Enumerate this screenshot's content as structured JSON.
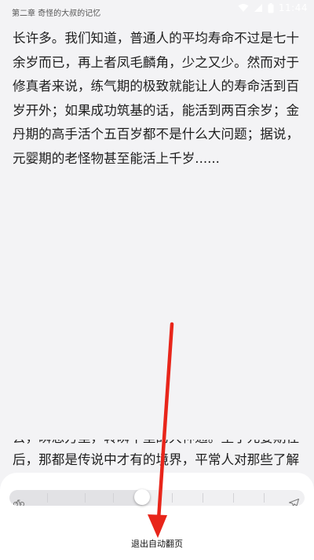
{
  "status_bar": {
    "time": "11:44"
  },
  "chapter": {
    "title": "第二章 奇怪的大叔的记忆"
  },
  "content": {
    "paragraph": "长许多。我们知道，普通人的平均寿命不过是七十余岁而已，再上者凤毛麟角，少之又少。然而对于修真者来说，练气期的极致就能让人的寿命活到百岁开外；如果成功筑基的话，能活到两百余岁；金丹期的高手活个五百岁都不是什么大问题；据说，元婴期的老怪物甚至能活上千岁......",
    "partial_lines": [
      "去，瞬息万里，转瞬千里的大神通。至于元婴期往",
      "后，那都是传说中才有的境界，平常人对那些了解"
    ]
  },
  "auto_page": {
    "speed_fraction": 0.45,
    "slow_icon": "bicycle-icon",
    "fast_icon": "paper-plane-icon",
    "exit_label": "退出自动翻页"
  },
  "annotation": {
    "arrow_color": "#e8251a"
  }
}
